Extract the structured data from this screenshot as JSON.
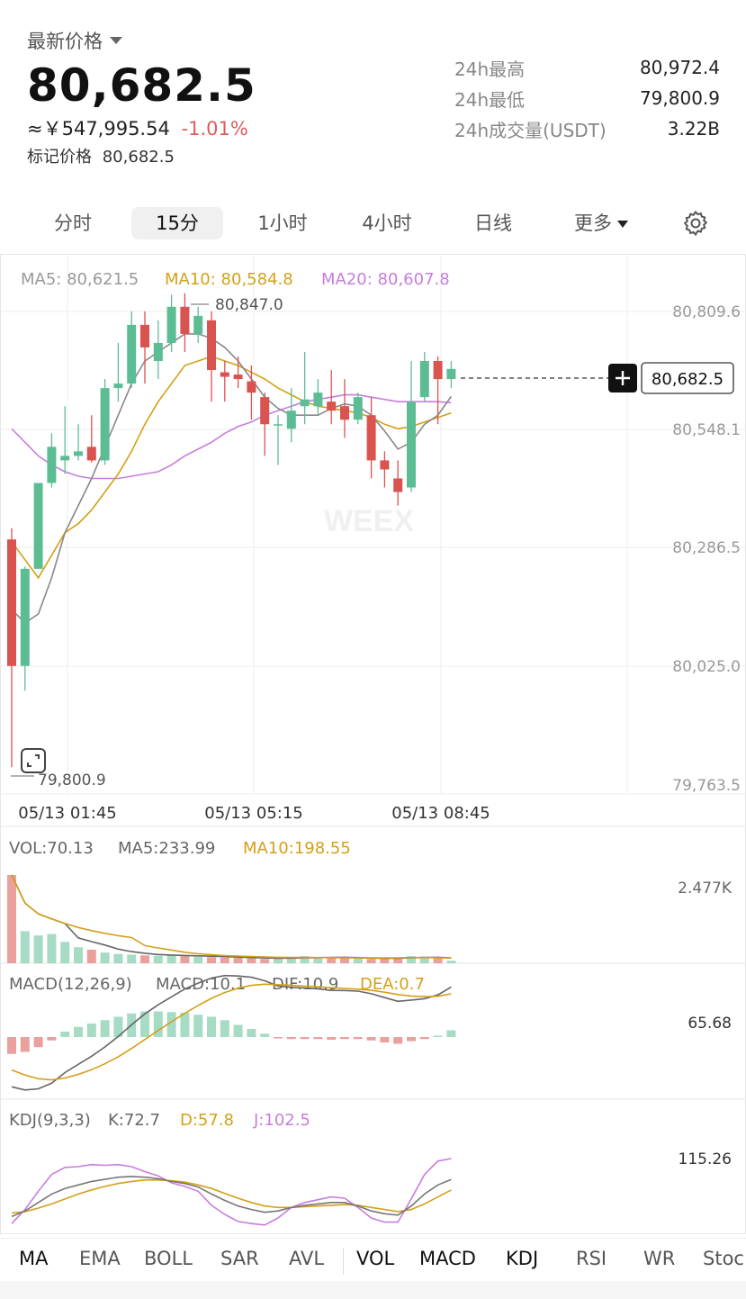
{
  "header": {
    "price_label": "最新价格",
    "last_price": "80,682.5",
    "cny_price": "≈￥547,995.54",
    "change_pct": "-1.01%",
    "mark_price_label": "标记价格",
    "mark_price": "80,682.5",
    "stats": [
      {
        "label": "24h最高",
        "value": "80,972.4"
      },
      {
        "label": "24h最低",
        "value": "79,800.9"
      },
      {
        "label": "24h成交量(USDT)",
        "value": "3.22B"
      }
    ]
  },
  "timeframes": {
    "items": [
      "分时",
      "15分",
      "1小时",
      "4小时",
      "日线",
      "更多"
    ],
    "active": "15分"
  },
  "main_chart": {
    "ma_legend": [
      {
        "label": "MA5: 80,621.5",
        "color": "#999999"
      },
      {
        "label": "MA10: 80,584.8",
        "color": "#d4a017"
      },
      {
        "label": "MA20: 80,607.8",
        "color": "#c77dde"
      }
    ],
    "y_ticks": [
      "80,809.6",
      "80,548.1",
      "80,286.5",
      "80,025.0",
      "79,763.5"
    ],
    "high_label": "80,847.0",
    "low_label": "79,800.9",
    "current_label": "80,682.5",
    "x_labels": [
      "05/13 01:45",
      "05/13 05:15",
      "05/13 08:45"
    ],
    "watermark": "WEEX"
  },
  "vol_panel": {
    "legend": [
      {
        "label": "VOL:70.13",
        "color": "#666666"
      },
      {
        "label": "MA5:233.99",
        "color": "#666666"
      },
      {
        "label": "MA10:198.55",
        "color": "#d4a017"
      }
    ],
    "max_label": "2.477K"
  },
  "macd_panel": {
    "legend": [
      {
        "label": "MACD(12,26,9)",
        "color": "#666666"
      },
      {
        "label": "MACD:10.1",
        "color": "#666666"
      },
      {
        "label": "DIF:10.9",
        "color": "#666666"
      },
      {
        "label": "DEA:0.7",
        "color": "#d4a017"
      }
    ],
    "max_label": "65.68"
  },
  "kdj_panel": {
    "legend": [
      {
        "label": "KDJ(9,3,3)",
        "color": "#666666"
      },
      {
        "label": "K:72.7",
        "color": "#666666"
      },
      {
        "label": "D:57.8",
        "color": "#d4a017"
      },
      {
        "label": "J:102.5",
        "color": "#c77dde"
      }
    ],
    "max_label": "115.26"
  },
  "indicators": {
    "items": [
      "MA",
      "EMA",
      "BOLL",
      "SAR",
      "AVL",
      "VOL",
      "MACD",
      "KDJ",
      "RSI",
      "WR",
      "Stoc"
    ],
    "active_main": "MA",
    "active_sub": [
      "VOL",
      "MACD",
      "KDJ"
    ]
  },
  "colors": {
    "up": "#5cbd94",
    "down": "#d9534f",
    "ma5": "#888888",
    "ma10": "#d4a017",
    "ma20": "#c77dde"
  },
  "chart_data": {
    "type": "candlestick",
    "y_range": [
      79763.5,
      80870
    ],
    "candles": [
      {
        "o": 80305,
        "c": 80025,
        "h": 80330,
        "l": 79800.9
      },
      {
        "o": 80025,
        "c": 80240,
        "h": 80245,
        "l": 79970
      },
      {
        "o": 80240,
        "c": 80430,
        "h": 80430,
        "l": 80240
      },
      {
        "o": 80430,
        "c": 80510,
        "h": 80540,
        "l": 80420
      },
      {
        "o": 80480,
        "c": 80490,
        "h": 80600,
        "l": 80450
      },
      {
        "o": 80490,
        "c": 80500,
        "h": 80560,
        "l": 80480
      },
      {
        "o": 80510,
        "c": 80480,
        "h": 80580,
        "l": 80475
      },
      {
        "o": 80480,
        "c": 80640,
        "h": 80660,
        "l": 80470
      },
      {
        "o": 80640,
        "c": 80650,
        "h": 80740,
        "l": 80610
      },
      {
        "o": 80650,
        "c": 80780,
        "h": 80810,
        "l": 80640
      },
      {
        "o": 80780,
        "c": 80730,
        "h": 80810,
        "l": 80650
      },
      {
        "o": 80700,
        "c": 80740,
        "h": 80790,
        "l": 80660
      },
      {
        "o": 80740,
        "c": 80820,
        "h": 80847,
        "l": 80720
      },
      {
        "o": 80820,
        "c": 80760,
        "h": 80850,
        "l": 80720
      },
      {
        "o": 80760,
        "c": 80800,
        "h": 80820,
        "l": 80740
      },
      {
        "o": 80790,
        "c": 80680,
        "h": 80810,
        "l": 80610
      },
      {
        "o": 80675,
        "c": 80665,
        "h": 80700,
        "l": 80610
      },
      {
        "o": 80670,
        "c": 80660,
        "h": 80710,
        "l": 80640
      },
      {
        "o": 80655,
        "c": 80630,
        "h": 80690,
        "l": 80570
      },
      {
        "o": 80620,
        "c": 80560,
        "h": 80630,
        "l": 80490
      },
      {
        "o": 80560,
        "c": 80560,
        "h": 80580,
        "l": 80470
      },
      {
        "o": 80550,
        "c": 80590,
        "h": 80640,
        "l": 80520
      },
      {
        "o": 80600,
        "c": 80615,
        "h": 80720,
        "l": 80560
      },
      {
        "o": 80600,
        "c": 80630,
        "h": 80660,
        "l": 80580
      },
      {
        "o": 80610,
        "c": 80590,
        "h": 80680,
        "l": 80560
      },
      {
        "o": 80600,
        "c": 80570,
        "h": 80660,
        "l": 80530
      },
      {
        "o": 80570,
        "c": 80620,
        "h": 80630,
        "l": 80560
      },
      {
        "o": 80580,
        "c": 80480,
        "h": 80620,
        "l": 80440
      },
      {
        "o": 80480,
        "c": 80460,
        "h": 80500,
        "l": 80420
      },
      {
        "o": 80440,
        "c": 80410,
        "h": 80480,
        "l": 80380
      },
      {
        "o": 80420,
        "c": 80610,
        "h": 80700,
        "l": 80410
      },
      {
        "o": 80620,
        "c": 80700,
        "h": 80720,
        "l": 80610
      },
      {
        "o": 80700,
        "c": 80660,
        "h": 80710,
        "l": 80560
      },
      {
        "o": 80660,
        "c": 80682.5,
        "h": 80700,
        "l": 80640
      }
    ],
    "ma5": [
      80150,
      80120,
      80140,
      80220,
      80320,
      80380,
      80440,
      80510,
      80580,
      80650,
      80700,
      80720,
      80740,
      80760,
      80760,
      80750,
      80730,
      80700,
      80660,
      80620,
      80595,
      80580,
      80580,
      80580,
      80595,
      80605,
      80600,
      80580,
      80545,
      80505,
      80520,
      80560,
      80580,
      80621.5
    ],
    "ma10": [
      80300,
      80260,
      80220,
      80270,
      80320,
      80340,
      80370,
      80410,
      80450,
      80500,
      80560,
      80610,
      80650,
      80690,
      80700,
      80710,
      80700,
      80690,
      80675,
      80660,
      80640,
      80625,
      80610,
      80600,
      80595,
      80590,
      80585,
      80575,
      80560,
      80550,
      80555,
      80565,
      80575,
      80584.8
    ],
    "ma20": [
      80550,
      80520,
      80490,
      80470,
      80455,
      80445,
      80440,
      80440,
      80440,
      80445,
      80450,
      80455,
      80470,
      80490,
      80505,
      80520,
      80540,
      80555,
      80565,
      80580,
      80590,
      80600,
      80610,
      80615,
      80620,
      80625,
      80625,
      80620,
      80615,
      80610,
      80610,
      80610,
      80610,
      80607.8
    ],
    "volume": [
      2477,
      900,
      780,
      820,
      600,
      450,
      380,
      300,
      260,
      240,
      220,
      210,
      220,
      200,
      180,
      170,
      160,
      150,
      140,
      120,
      130,
      180,
      200,
      150,
      160,
      140,
      150,
      120,
      140,
      150,
      200,
      190,
      150,
      70.13
    ],
    "macd_hist": [
      -25,
      -22,
      -15,
      -5,
      8,
      15,
      20,
      25,
      30,
      35,
      38,
      38,
      37,
      36,
      33,
      30,
      25,
      18,
      12,
      5,
      -2,
      -3,
      -3,
      -3,
      -4,
      -3,
      -3,
      -5,
      -8,
      -10,
      -6,
      -3,
      2,
      10.1
    ],
    "kdj_k": [
      20,
      28,
      40,
      52,
      60,
      65,
      70,
      73,
      76,
      77,
      76,
      74,
      70,
      67,
      62,
      52,
      43,
      35,
      30,
      26,
      28,
      33,
      36,
      38,
      40,
      40,
      35,
      28,
      24,
      22,
      35,
      52,
      65,
      72.7
    ],
    "kdj_d": [
      25,
      27,
      32,
      38,
      45,
      52,
      58,
      63,
      67,
      70,
      72,
      72,
      71,
      69,
      65,
      60,
      53,
      46,
      40,
      35,
      33,
      33,
      34,
      35,
      36,
      37,
      36,
      33,
      30,
      27,
      30,
      38,
      48,
      57.8
    ]
  }
}
